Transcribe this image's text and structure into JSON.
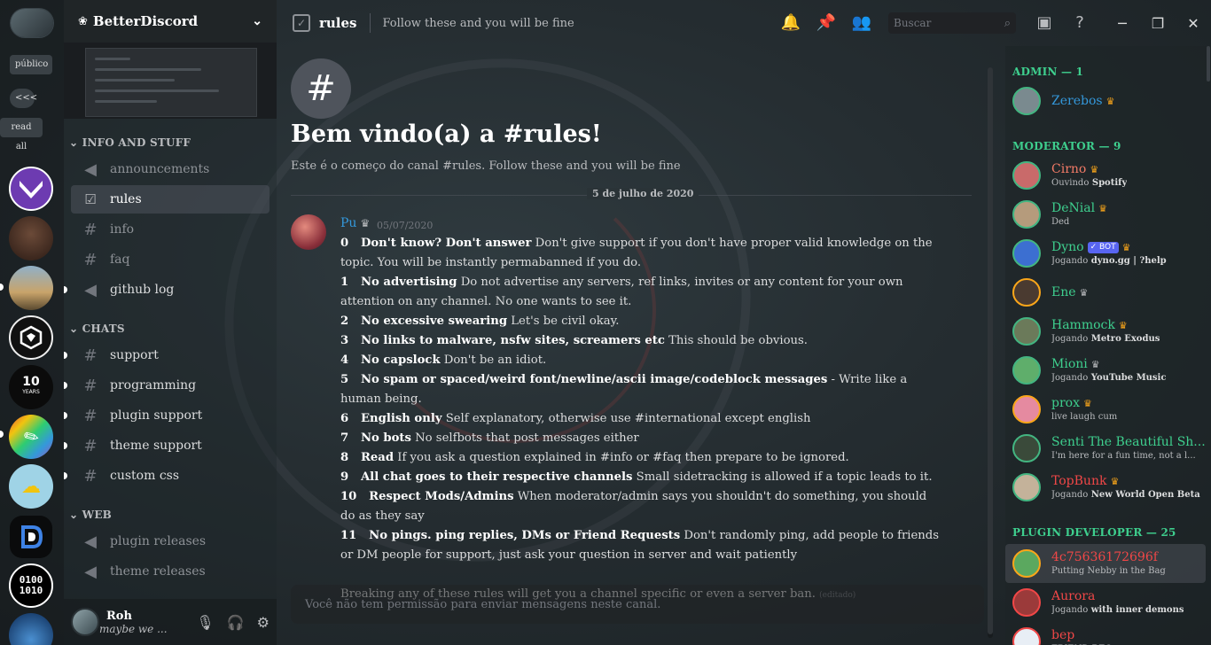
{
  "server": {
    "name": "BetterDiscord"
  },
  "guild_bar": {
    "public_label": "público",
    "collapse_label": "<<<",
    "read_all_label": "read all",
    "anniversary_badge": "10",
    "anniversary_sub": "YEARS",
    "binary_top": "0100",
    "binary_bottom": "1010"
  },
  "categories": {
    "info": "INFO AND STUFF",
    "chats": "CHATS",
    "web": "WEB"
  },
  "channels": [
    {
      "name": "announcements",
      "icon": "megaphone-icon"
    },
    {
      "name": "rules",
      "icon": "rules-icon"
    },
    {
      "name": "info",
      "icon": "hash-icon"
    },
    {
      "name": "faq",
      "icon": "hash-icon"
    },
    {
      "name": "github log",
      "icon": "megaphone-icon"
    },
    {
      "name": "support",
      "icon": "hash-icon"
    },
    {
      "name": "programming",
      "icon": "hash-icon"
    },
    {
      "name": "plugin support",
      "icon": "hash-icon"
    },
    {
      "name": "theme support",
      "icon": "hash-icon"
    },
    {
      "name": "custom css",
      "icon": "hash-icon"
    },
    {
      "name": "plugin releases",
      "icon": "megaphone-icon"
    },
    {
      "name": "theme releases",
      "icon": "megaphone-icon"
    }
  ],
  "user": {
    "name": "Roh",
    "status": "maybe we ..."
  },
  "topbar": {
    "channel_name": "rules",
    "topic": "Follow these and you will be fine",
    "search_placeholder": "Buscar"
  },
  "welcome": {
    "title": "Bem vindo(a) a #rules!",
    "subtitle": "Este é o começo do canal #rules. Follow these and you will be fine",
    "date_divider": "5 de julho de 2020"
  },
  "message": {
    "author": "Pu",
    "timestamp": "05/07/2020",
    "rules": [
      {
        "n": "0",
        "title": "Don't know? Don't answer",
        "text": "Don't give support if you don't have proper valid knowledge on the topic. You will be instantly permabanned if you do."
      },
      {
        "n": "1",
        "title": "No advertising",
        "text": "Do not advertise any servers, ref links, invites or any content for your own attention on any channel. No one wants to see it."
      },
      {
        "n": "2",
        "title": "No excessive swearing",
        "text": "Let's be civil okay."
      },
      {
        "n": "3",
        "title": "No links to malware, nsfw sites, screamers etc",
        "text": "This should be obvious."
      },
      {
        "n": "4",
        "title": "No capslock",
        "text": "Don't be an idiot."
      },
      {
        "n": "5",
        "title": "No spam or spaced/weird font/newline/ascii image/codeblock messages",
        "text": "- Write like a human being."
      },
      {
        "n": "6",
        "title": "English only",
        "text": "Self explanatory, otherwise use #international except english"
      },
      {
        "n": "7",
        "title": "No bots",
        "text": "No selfbots that post messages either"
      },
      {
        "n": "8",
        "title": "Read",
        "text": "If you ask a question explained in #info or #faq then prepare to be ignored."
      },
      {
        "n": "9",
        "title": "All chat goes to their respective channels",
        "text": "Small sidetracking is allowed if a topic leads to it."
      },
      {
        "n": "10",
        "title": "Respect Mods/Admins",
        "text": "When moderator/admin says you shouldn't do something, you should do as they say"
      },
      {
        "n": "11",
        "title": "No pings. ping replies, DMs or Friend Requests",
        "text": "Don't randomly ping, add people to friends or DM people for support, just ask your question in server and wait patiently"
      }
    ],
    "footer": "Breaking any of these rules will get you a channel specific or even a server ban.",
    "edited": "(editado)"
  },
  "composer": {
    "placeholder": "Você não tem permissão para enviar mensagens neste canal."
  },
  "members": {
    "admin_header": "ADMIN — 1",
    "moderator_header": "MODERATOR — 9",
    "plugin_dev_header": "PLUGIN DEVELOPER — 25",
    "list": [
      {
        "name": "Zerebos",
        "status": "",
        "color": "#3498db"
      },
      {
        "name": "Cirno",
        "status": "Ouvindo",
        "status_bold": "Spotify",
        "color": "#f47b67"
      },
      {
        "name": "DeNial",
        "status": "Ded",
        "status_bold": "",
        "color": "#3ecf8e"
      },
      {
        "name": "Dyno",
        "status": "Jogando",
        "status_bold": "dyno.gg | ?help",
        "color": "#3ecf8e",
        "badge": "BOT"
      },
      {
        "name": "Ene",
        "status": "",
        "status_bold": "",
        "color": "#3ecf8e"
      },
      {
        "name": "Hammock",
        "status": "Jogando",
        "status_bold": "Metro Exodus",
        "color": "#3ecf8e"
      },
      {
        "name": "Mioni",
        "status": "Jogando",
        "status_bold": "YouTube Music",
        "color": "#3ecf8e"
      },
      {
        "name": "prox",
        "status": "live laugh cum",
        "status_bold": "",
        "color": "#3ecf8e"
      },
      {
        "name": "Senti The Beautiful Sh...",
        "status": "I'm here for a fun time, not a l...",
        "status_bold": "",
        "color": "#3ecf8e"
      },
      {
        "name": "TopBunk",
        "status": "Jogando",
        "status_bold": "New World Open Beta",
        "color": "#f04747"
      },
      {
        "name": "4c75636172696f",
        "status": "Putting Nebby in the Bag",
        "status_bold": "",
        "color": "#f04747"
      },
      {
        "name": "Aurora",
        "status": "Jogando",
        "status_bold": "with inner demons",
        "color": "#f04747"
      },
      {
        "name": "bep",
        "status": "FRIEND REQ...",
        "status_bold": "",
        "color": "#f04747"
      }
    ]
  }
}
